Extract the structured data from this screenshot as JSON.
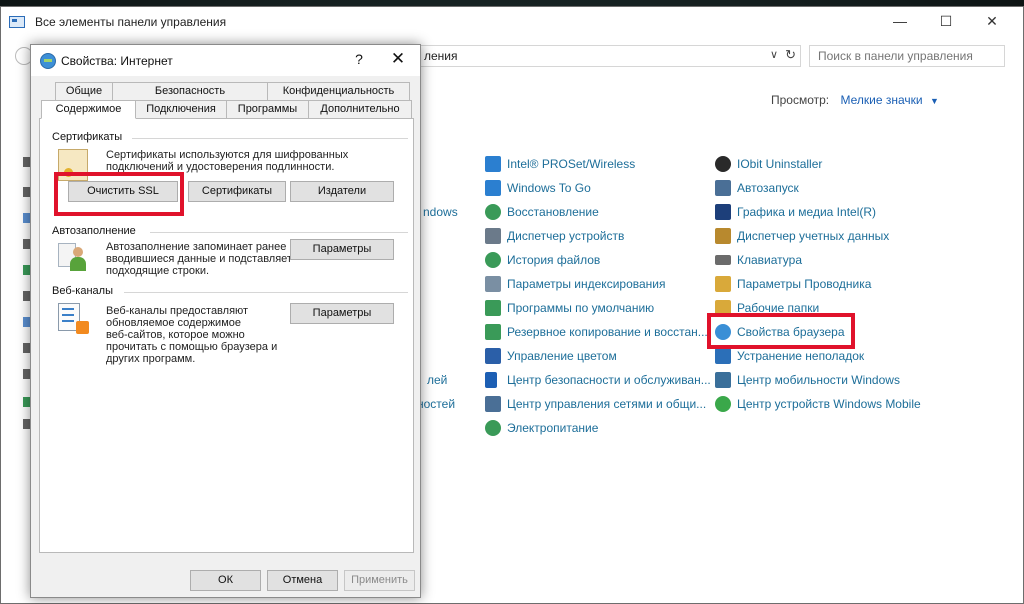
{
  "control_panel": {
    "title": "Все элементы панели управления",
    "window_buttons": {
      "minimize": "—",
      "maximize": "☐",
      "close": "✕"
    },
    "address": "ления",
    "search_placeholder": "Поиск в панели управления",
    "view_label": "Просмотр:",
    "view_value": "Мелкие значки",
    "left_fragments": [
      "ndows",
      "лей",
      "ностей"
    ],
    "items_col1": [
      {
        "label": "Intel® PROSet/Wireless",
        "icon": "wireless-icon",
        "color": "#2b7fd0"
      },
      {
        "label": "Windows To Go",
        "icon": "windows-to-go-icon",
        "color": "#2b7fd0"
      },
      {
        "label": "Восстановление",
        "icon": "recovery-icon",
        "color": "#3a9a58"
      },
      {
        "label": "Диспетчер устройств",
        "icon": "device-manager-icon",
        "color": "#6b7a8a"
      },
      {
        "label": "История файлов",
        "icon": "file-history-icon",
        "color": "#3a9a58"
      },
      {
        "label": "Параметры индексирования",
        "icon": "indexing-icon",
        "color": "#7a8fa3"
      },
      {
        "label": "Программы по умолчанию",
        "icon": "default-programs-icon",
        "color": "#3a9a58"
      },
      {
        "label": "Резервное копирование и восстан...",
        "icon": "backup-icon",
        "color": "#3a9a58"
      },
      {
        "label": "Управление цветом",
        "icon": "color-management-icon",
        "color": "#2b5fa8"
      },
      {
        "label": "Центр безопасности и обслуживан...",
        "icon": "security-flag-icon",
        "color": "#1d5fb4"
      },
      {
        "label": "Центр управления сетями и общи...",
        "icon": "network-icon",
        "color": "#4a6f96"
      },
      {
        "label": "Электропитание",
        "icon": "power-icon",
        "color": "#3a9a58"
      }
    ],
    "items_col2": [
      {
        "label": "IObit Uninstaller",
        "icon": "iobit-icon",
        "color": "#2a2a2a"
      },
      {
        "label": "Автозапуск",
        "icon": "autoplay-icon",
        "color": "#4a6f96"
      },
      {
        "label": "Графика и медиа Intel(R)",
        "icon": "intel-graphics-icon",
        "color": "#1d3f7a"
      },
      {
        "label": "Диспетчер учетных данных",
        "icon": "credentials-icon",
        "color": "#b8892e"
      },
      {
        "label": "Клавиатура",
        "icon": "keyboard-icon",
        "color": "#6b6b6b"
      },
      {
        "label": "Параметры Проводника",
        "icon": "explorer-options-icon",
        "color": "#d9a93a"
      },
      {
        "label": "Рабочие папки",
        "icon": "work-folders-icon",
        "color": "#d9a93a"
      },
      {
        "label": "Свойства браузера",
        "icon": "browser-properties-icon",
        "color": "#3a8fd6"
      },
      {
        "label": "Устранение неполадок",
        "icon": "troubleshooting-icon",
        "color": "#2b6fb8"
      },
      {
        "label": "Центр мобильности Windows",
        "icon": "mobility-center-icon",
        "color": "#3a6f9a"
      },
      {
        "label": "Центр устройств Windows Mobile",
        "icon": "windows-mobile-icon",
        "color": "#3aa84a"
      }
    ]
  },
  "dialog": {
    "title": "Свойства: Интернет",
    "help": "?",
    "close": "✕",
    "tabs_row1": [
      "Общие",
      "Безопасность",
      "Конфиденциальность"
    ],
    "tabs_row2": [
      "Содержимое",
      "Подключения",
      "Программы",
      "Дополнительно"
    ],
    "certificates": {
      "header": "Сертификаты",
      "text_line1": "Сертификаты используются для шифрованных",
      "text_line2": "подключений и удостоверения подлинности.",
      "clear_ssl": "Очистить SSL",
      "certificates_btn": "Сертификаты",
      "publishers_btn": "Издатели"
    },
    "autocomplete": {
      "header": "Автозаполнение",
      "text_line1": "Автозаполнение запоминает ранее",
      "text_line2": "вводившиеся данные и подставляет",
      "text_line3": "подходящие строки.",
      "settings_btn": "Параметры"
    },
    "feeds": {
      "header": "Веб-каналы",
      "text_line1": "Веб-каналы предоставляют",
      "text_line2": "обновляемое содержимое",
      "text_line3": "веб-сайтов, которое можно",
      "text_line4": "прочитать с помощью браузера и",
      "text_line5": "других программ.",
      "settings_btn": "Параметры"
    },
    "buttons": {
      "ok": "ОК",
      "cancel": "Отмена",
      "apply": "Применить"
    }
  },
  "colors": {
    "highlight_frame": "#e0122b",
    "link": "#1d6e99",
    "accent": "#1a5fb4"
  }
}
